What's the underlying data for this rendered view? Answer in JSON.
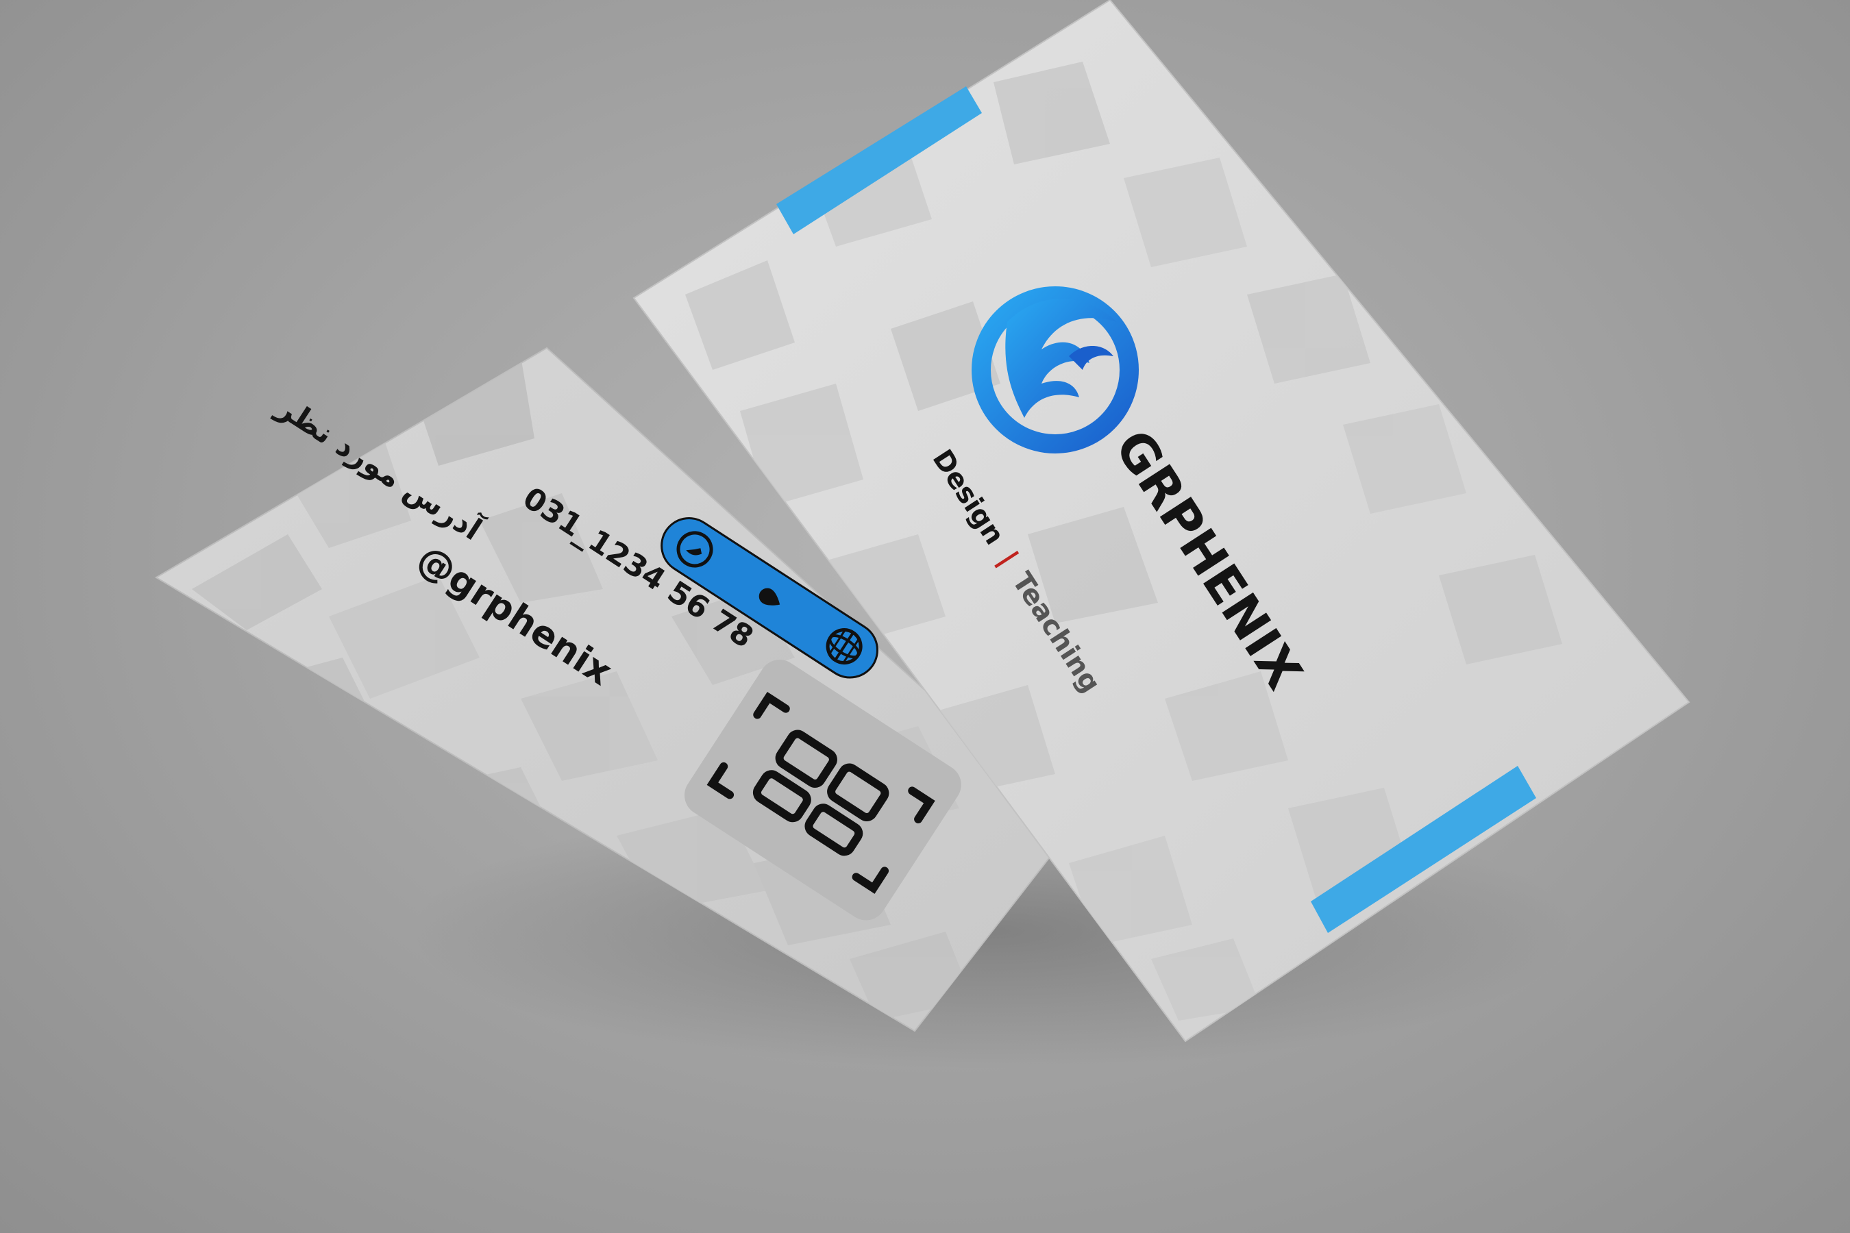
{
  "brand": {
    "name": "GRPHENIX",
    "tagline_left": "Design",
    "tagline_sep": "|",
    "tagline_right": "Teaching"
  },
  "contact": {
    "phone": "031_1234  56  78",
    "address": "آدرس مورد نظر",
    "handle": "@grphenix",
    "icons": [
      "phone-icon",
      "location-pin-icon",
      "globe-icon"
    ]
  },
  "colors": {
    "accent": "#3ea9e6",
    "pill": "#1f84d8",
    "card": "#d7d7d7",
    "separator": "#c0231e"
  }
}
